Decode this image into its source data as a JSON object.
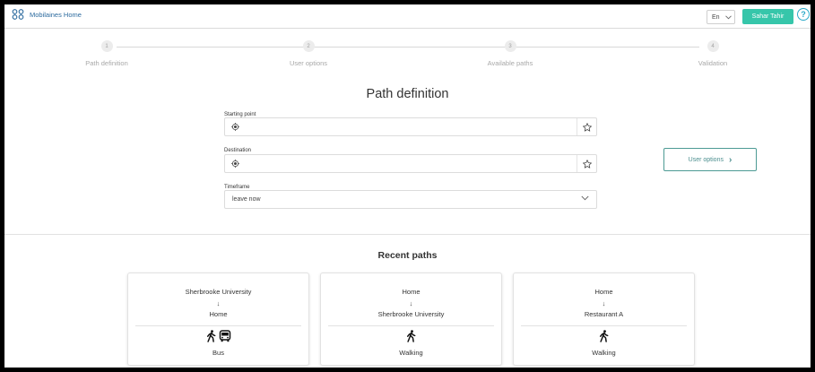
{
  "header": {
    "brand": "Mobilaines Home",
    "language": "En",
    "user": "Sahar Tahir",
    "help_symbol": "?"
  },
  "stepper": {
    "steps": [
      {
        "number": "1",
        "label": "Path definition",
        "active": true
      },
      {
        "number": "2",
        "label": "User options",
        "active": false
      },
      {
        "number": "3",
        "label": "Available paths",
        "active": false
      },
      {
        "number": "4",
        "label": "Validation",
        "active": false
      }
    ]
  },
  "form": {
    "title": "Path definition",
    "starting_point": {
      "label": "Starting point",
      "value": "",
      "icon": "location-target-icon",
      "action_icon": "star-icon"
    },
    "destination": {
      "label": "Destination",
      "value": "",
      "icon": "location-target-icon",
      "action_icon": "star-icon"
    },
    "timeframe": {
      "label": "Timeframe",
      "selected": "leave now"
    },
    "next_button": "User options",
    "next_arrow": "›"
  },
  "recent": {
    "title": "Recent paths",
    "arrow_glyph": "↓",
    "cards": [
      {
        "from": "Sherbrooke University",
        "to": "Home",
        "mode": "Bus",
        "icons": [
          "walking-icon",
          "bus-icon"
        ]
      },
      {
        "from": "Home",
        "to": "Sherbrooke University",
        "mode": "Walking",
        "icons": [
          "walking-icon"
        ]
      },
      {
        "from": "Home",
        "to": "Restaurant A",
        "mode": "Walking",
        "icons": [
          "walking-icon"
        ]
      }
    ]
  },
  "colors": {
    "accent": "#36c6aa",
    "step_active": "#4c8f8f",
    "brand_text": "#2b6a9e",
    "help": "#29a9c8"
  }
}
